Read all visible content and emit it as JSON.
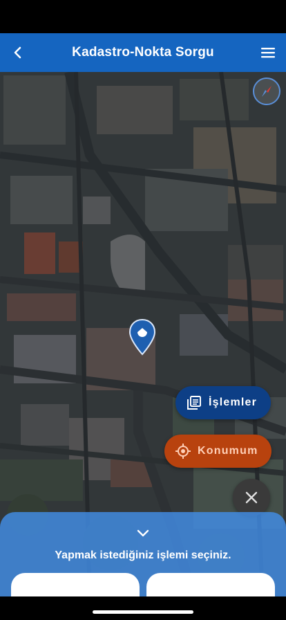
{
  "header": {
    "title": "Kadastro-Nokta Sorgu",
    "back_icon": "chevron-left-icon",
    "menu_icon": "hamburger-menu-icon"
  },
  "map": {
    "compass_icon": "compass-icon",
    "pin_icon": "location-pin-icon"
  },
  "actions": {
    "islemler_label": "İşlemler",
    "islemler_icon": "layers-list-icon",
    "konum_label": "Konumum",
    "konum_icon": "crosshair-location-icon",
    "close_icon": "close-icon"
  },
  "sheet": {
    "prompt": "Yapmak istediğiniz işlemi seçiniz.",
    "chevron_icon": "chevron-down-icon"
  },
  "colors": {
    "appbar": "#1565c0",
    "islemler_fab": "#0d3f86",
    "konum_fab": "#b8420e",
    "sheet": "#428ee6"
  }
}
